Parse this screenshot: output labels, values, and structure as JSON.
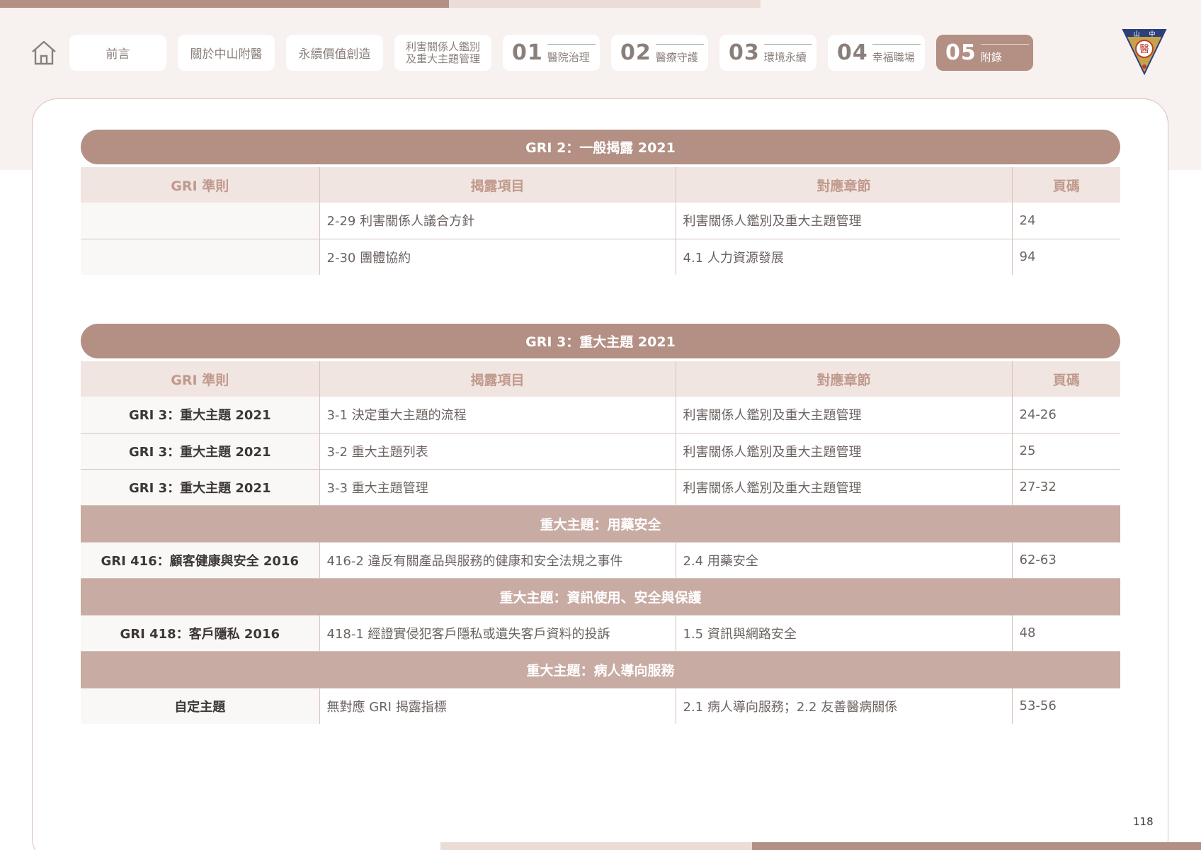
{
  "nav": {
    "items": [
      {
        "label": "前言"
      },
      {
        "label": "關於中山附醫"
      },
      {
        "label": "永續價值創造"
      },
      {
        "line1": "利害關係人鑑別",
        "line2": "及重大主題管理"
      },
      {
        "num": "01",
        "label": "醫院治理"
      },
      {
        "num": "02",
        "label": "醫療守護"
      },
      {
        "num": "03",
        "label": "環境永續"
      },
      {
        "num": "04",
        "label": "幸福職場"
      },
      {
        "num": "05",
        "label": "附錄"
      }
    ],
    "active_index": 8
  },
  "emblem_text": [
    "山",
    "中",
    "醫"
  ],
  "table1": {
    "title": "GRI 2：一般揭露 2021",
    "headers": [
      "GRI 準則",
      "揭露項目",
      "對應章節",
      "頁碼"
    ],
    "rows": [
      [
        "",
        "2-29 利害關係人議合方針",
        "利害關係人鑑別及重大主題管理",
        "24"
      ],
      [
        "",
        "2-30 團體協約",
        "4.1 人力資源發展",
        "94"
      ]
    ]
  },
  "table2": {
    "title": "GRI 3：重大主題 2021",
    "headers": [
      "GRI 準則",
      "揭露項目",
      "對應章節",
      "頁碼"
    ],
    "rows": [
      [
        "GRI 3：重大主題 2021",
        "3-1 決定重大主題的流程",
        "利害關係人鑑別及重大主題管理",
        "24-26"
      ],
      [
        "GRI 3：重大主題 2021",
        "3-2 重大主題列表",
        "利害關係人鑑別及重大主題管理",
        "25"
      ],
      [
        "GRI 3：重大主題 2021",
        "3-3 重大主題管理",
        "利害關係人鑑別及重大主題管理",
        "27-32"
      ]
    ],
    "sections": [
      {
        "title": "重大主題：用藥安全",
        "row": [
          "GRI 416：顧客健康與安全 2016",
          "416-2 違反有關產品與服務的健康和安全法規之事件",
          "2.4 用藥安全",
          "62-63"
        ]
      },
      {
        "title": "重大主題：資訊使用、安全與保護",
        "row": [
          "GRI 418：客戶隱私 2016",
          "418-1 經證實侵犯客戶隱私或遺失客戶資料的投訴",
          "1.5 資訊與網路安全",
          "48"
        ]
      },
      {
        "title": "重大主題：病人導向服務",
        "row": [
          "自定主題",
          "無對應 GRI 揭露指標",
          "2.1 病人導向服務；2.2 友善醫病關係",
          "53-56"
        ]
      }
    ]
  },
  "page_number": "118",
  "colors": {
    "accent": "#b38f84",
    "section": "#c8aba3",
    "header_bg": "#f1e5e1",
    "band": "#f7f2ef"
  }
}
